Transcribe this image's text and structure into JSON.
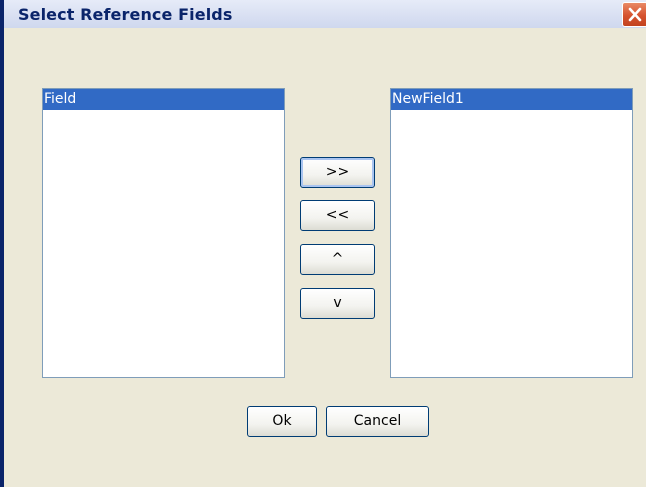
{
  "window": {
    "title": "Select Reference Fields",
    "close_icon": "close-icon",
    "accent_color": "#316ac5"
  },
  "available_list": {
    "items": [
      "Field"
    ],
    "selected_index": 0
  },
  "selected_list": {
    "items": [
      "NewField1"
    ],
    "selected_index": 0
  },
  "move_buttons": {
    "add_label": ">>",
    "remove_label": "<<",
    "up_label": "^",
    "down_label": "v"
  },
  "dialog_buttons": {
    "ok_label": "Ok",
    "cancel_label": "Cancel"
  }
}
